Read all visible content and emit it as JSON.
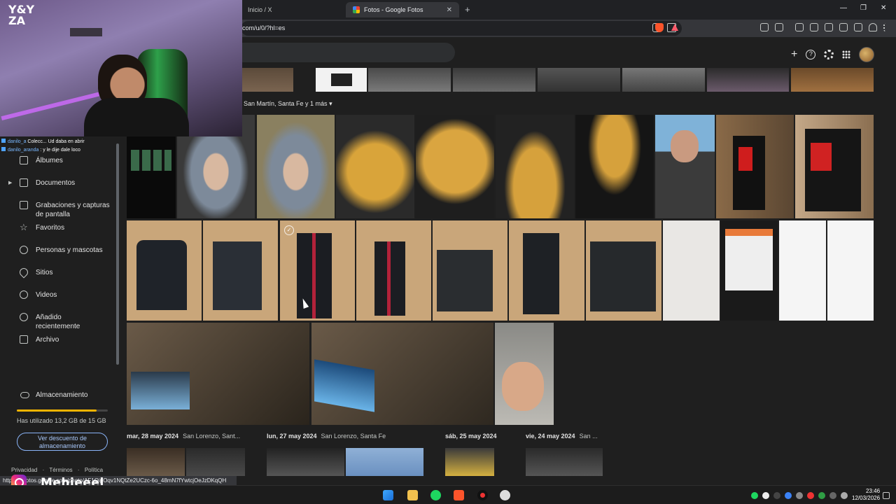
{
  "browser": {
    "tabs": [
      {
        "label": "Inicio / X",
        "active": false
      },
      {
        "label": "Fotos - Google Fotos",
        "active": true
      }
    ],
    "new_tab": "+",
    "address": "com/u/0/?hl=es",
    "window_controls": {
      "minimize": "—",
      "restore": "❐",
      "close": "✕"
    },
    "tab_close": "✕"
  },
  "photos": {
    "help_glyph": "?",
    "location_header": "San Martín, Santa Fe y 1 más",
    "date_rows": [
      {
        "date": "mar, 28 may 2024",
        "place": "San Lorenzo, Sant..."
      },
      {
        "date": "lun, 27 may 2024",
        "place": "San Lorenzo, Santa Fe"
      },
      {
        "date": "sáb, 25 may 2024",
        "place": ""
      },
      {
        "date": "vie, 24 may 2024",
        "place": "San ..."
      }
    ]
  },
  "sidebar": {
    "items": [
      {
        "label": "Álbumes",
        "icon": "albums-icon"
      },
      {
        "label": "Documentos",
        "icon": "documents-icon"
      },
      {
        "label": "Grabaciones y capturas de pantalla",
        "icon": "screenshots-icon"
      },
      {
        "label": "Favoritos",
        "icon": "star-icon"
      },
      {
        "label": "Personas y mascotas",
        "icon": "people-icon"
      },
      {
        "label": "Sitios",
        "icon": "location-pin-icon"
      },
      {
        "label": "Videos",
        "icon": "play-icon"
      },
      {
        "label": "Añadido recientemente",
        "icon": "clock-icon"
      },
      {
        "label": "Archivo",
        "icon": "archive-icon"
      }
    ],
    "storage": {
      "label": "Almacenamiento",
      "usage_text": "Has utilizado 13,2 GB de 15 GB",
      "used_fraction": 0.88,
      "button": "Ver descuento de almacenamiento"
    },
    "footer": {
      "privacy": "Privacidad",
      "terms": "Términos",
      "policy": "Política",
      "separator": "·"
    }
  },
  "stream_overlay": {
    "chat": [
      {
        "user": "danilo_a",
        "text": "Colecc... Ud daba en abrir"
      },
      {
        "user": "danilo_aranda",
        "text": ": y le dije dale loco"
      }
    ],
    "logo": "Y&Y\nZA",
    "instagram_handle": "Mehieeel"
  },
  "status_url": "https://photos.google.com/photo/AF1QipOqv1NQtZe2UCzc-6o_48mN7fYwtcjOeJzDKqQH",
  "clock": {
    "time": "23:46",
    "date": "12/03/2026"
  },
  "colors": {
    "accent": "#a8c7fa",
    "storage_fill": "#f4b400",
    "bg": "#1f1f1f"
  }
}
